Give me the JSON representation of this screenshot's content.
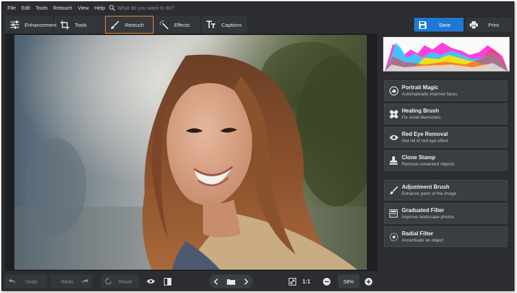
{
  "menu": {
    "items": [
      "File",
      "Edit",
      "Tools",
      "Retouch",
      "View",
      "Help"
    ],
    "search_placeholder": "What do you want to do?"
  },
  "tabs": [
    {
      "label": "Enhancement",
      "icon": "sliders-icon"
    },
    {
      "label": "Tools",
      "icon": "crop-icon"
    },
    {
      "label": "Retouch",
      "icon": "brush-icon",
      "active": true
    },
    {
      "label": "Effects",
      "icon": "magic-wand-icon"
    },
    {
      "label": "Captions",
      "icon": "text-icon"
    }
  ],
  "toolbar": {
    "save_label": "Save",
    "print_label": "Print"
  },
  "histogram": {
    "colors": [
      "#ff2bd6",
      "#26d7ff",
      "#ffe600",
      "#ff3030"
    ]
  },
  "retouch_tools": [
    {
      "title": "Portrait Magic",
      "desc": "Automatically improve faces",
      "icon": "portrait-icon"
    },
    {
      "title": "Healing Brush",
      "desc": "Fix small blemishes",
      "icon": "bandage-icon"
    },
    {
      "title": "Red Eye Removal",
      "desc": "Get rid of red eye effect",
      "icon": "eye-icon"
    },
    {
      "title": "Clone Stamp",
      "desc": "Remove unwanted objects",
      "icon": "stamp-icon"
    },
    {
      "title": "Adjustment Brush",
      "desc": "Enhance parts of the image",
      "icon": "brush-icon"
    },
    {
      "title": "Graduated Filter",
      "desc": "Improve landscape photos",
      "icon": "gradient-icon"
    },
    {
      "title": "Radial Filter",
      "desc": "Accentuate an object",
      "icon": "radial-icon"
    }
  ],
  "bottom": {
    "undo_label": "Undo",
    "redo_label": "Redo",
    "reset_label": "Reset",
    "one_to_one": "1:1",
    "zoom": "58%"
  },
  "colors": {
    "accent": "#f28c28",
    "save": "#1f79d4",
    "bg": "#2b2d30"
  }
}
